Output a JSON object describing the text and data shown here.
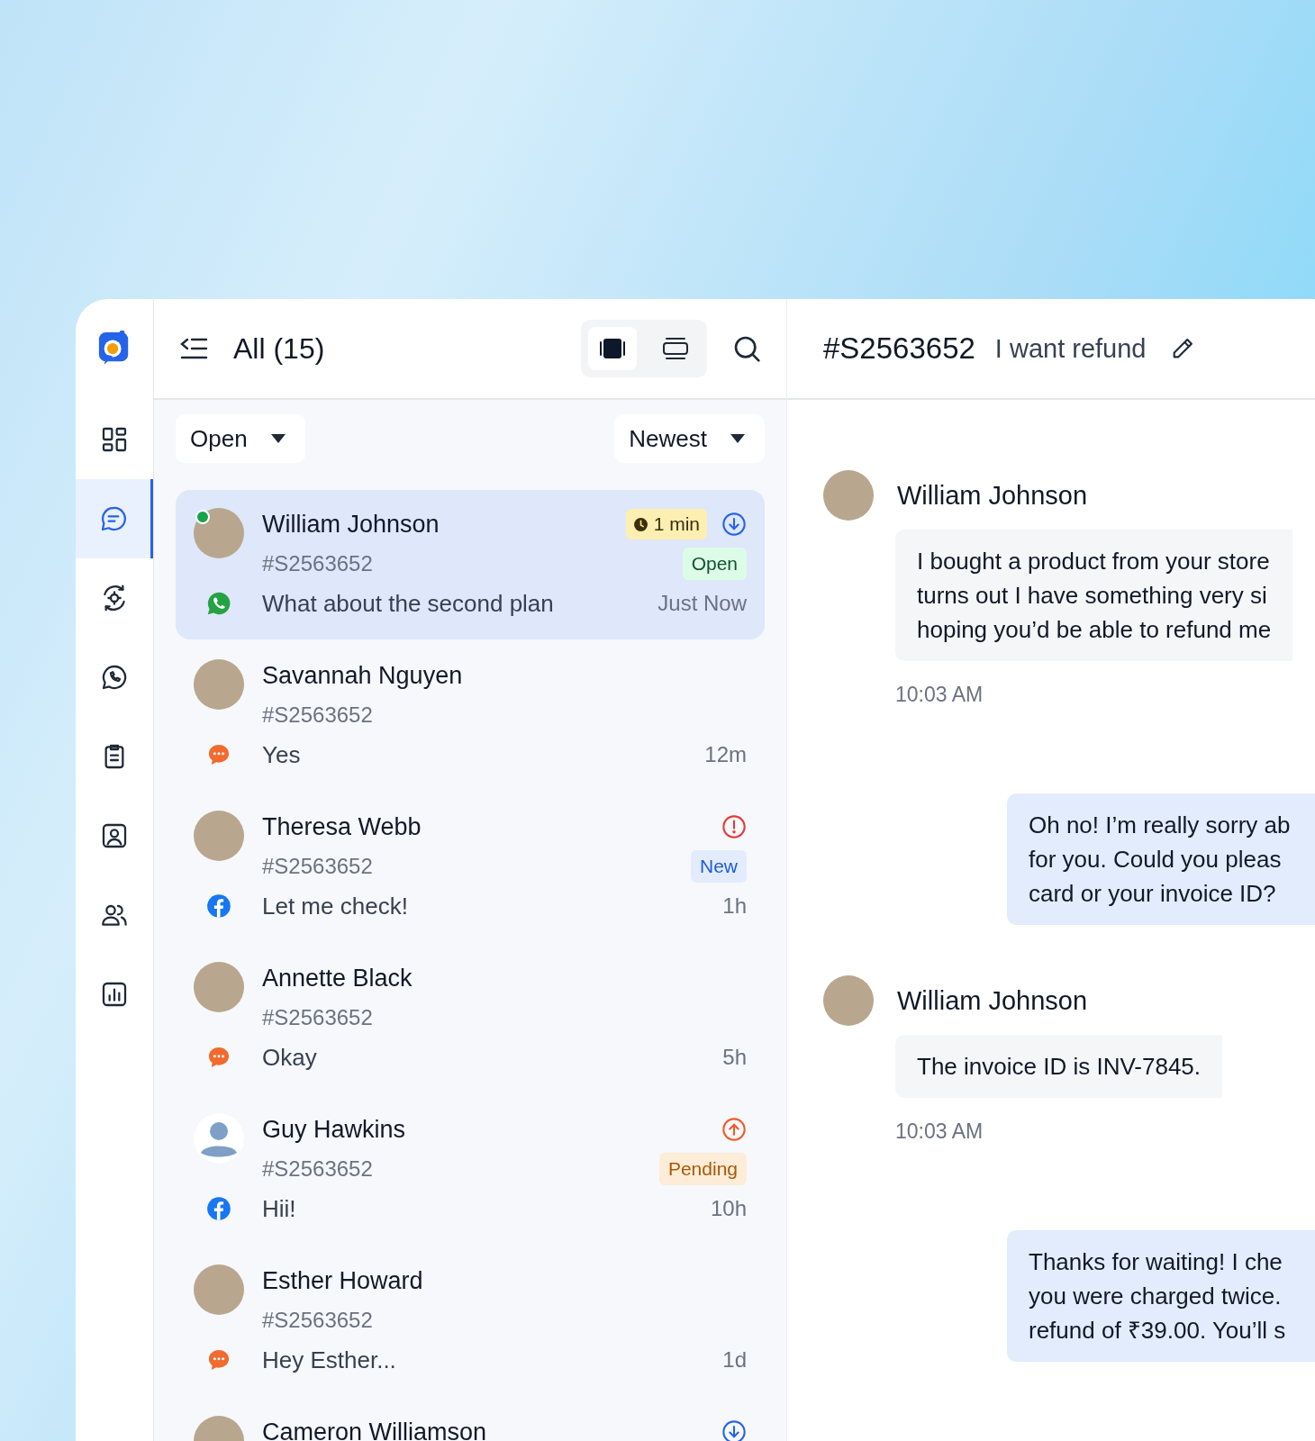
{
  "sidebar": {
    "items": [
      {
        "kind": "dashboard",
        "selected": false
      },
      {
        "kind": "conversations",
        "selected": true
      },
      {
        "kind": "automation",
        "selected": false
      },
      {
        "kind": "whatsapp",
        "selected": false
      },
      {
        "kind": "tasks",
        "selected": false
      },
      {
        "kind": "contact",
        "selected": false
      },
      {
        "kind": "team",
        "selected": false
      },
      {
        "kind": "reports",
        "selected": false
      }
    ]
  },
  "list_header": {
    "title": "All (15)",
    "view_modes": [
      {
        "kind": "card",
        "selected": true
      },
      {
        "kind": "compact",
        "selected": false
      }
    ]
  },
  "filters": {
    "status": "Open",
    "sort": "Newest"
  },
  "conversations": [
    {
      "name": "William Johnson",
      "ticket": "#S2563652",
      "message": "What about the second plan",
      "time": "Just Now",
      "channel": {
        "kind": "whatsapp"
      },
      "avatar": {
        "kind": "photo"
      },
      "online": true,
      "selected": true,
      "timer": "1 min",
      "indicator": {
        "kind": "down"
      },
      "badge": {
        "label": "Open",
        "kind": "open"
      }
    },
    {
      "name": "Savannah Nguyen",
      "ticket": "#S2563652",
      "message": "Yes",
      "time": "12m",
      "channel": {
        "kind": "livechat"
      },
      "avatar": {
        "kind": "photo"
      },
      "online": false,
      "selected": false
    },
    {
      "name": "Theresa Webb",
      "ticket": "#S2563652",
      "message": "Let me check!",
      "time": "1h",
      "channel": {
        "kind": "facebook"
      },
      "avatar": {
        "kind": "photo"
      },
      "online": false,
      "selected": false,
      "indicator": {
        "kind": "alert"
      },
      "badge": {
        "label": "New",
        "kind": "new"
      }
    },
    {
      "name": "Annette Black",
      "ticket": "#S2563652",
      "message": "Okay",
      "time": "5h",
      "channel": {
        "kind": "livechat"
      },
      "avatar": {
        "kind": "photo"
      },
      "online": false,
      "selected": false
    },
    {
      "name": "Guy Hawkins",
      "ticket": "#S2563652",
      "message": "Hii!",
      "time": "10h",
      "channel": {
        "kind": "facebook"
      },
      "avatar": {
        "kind": "silhouette"
      },
      "online": false,
      "selected": false,
      "indicator": {
        "kind": "up"
      },
      "badge": {
        "label": "Pending",
        "kind": "pending"
      }
    },
    {
      "name": "Esther Howard",
      "ticket": "#S2563652",
      "message": "Hey Esther...",
      "time": "1d",
      "channel": {
        "kind": "livechat"
      },
      "avatar": {
        "kind": "photo"
      },
      "online": false,
      "selected": false
    },
    {
      "name": "Cameron Williamson",
      "avatar": {
        "kind": "photo"
      },
      "online": false,
      "selected": false,
      "indicator": {
        "kind": "down"
      }
    }
  ],
  "chat": {
    "ticket": "#S2563652",
    "subject": "I want refund",
    "messages": [
      {
        "kind": "incoming",
        "author": "William Johnson",
        "text": "I bought a product from your store\nturns out I have something very si\nhoping you’d be able to refund me",
        "time": "10:03 AM"
      },
      {
        "kind": "outgoing",
        "text": "Oh no! I’m really sorry ab\nfor you. Could you pleas\ncard or your invoice ID?"
      },
      {
        "kind": "incoming",
        "author": "William Johnson",
        "text": "The invoice ID is INV-7845.",
        "time": "10:03 AM"
      },
      {
        "kind": "outgoing",
        "text": "Thanks for waiting! I che\nyou were charged twice.\nrefund of ₹39.00. You’ll s"
      }
    ]
  }
}
